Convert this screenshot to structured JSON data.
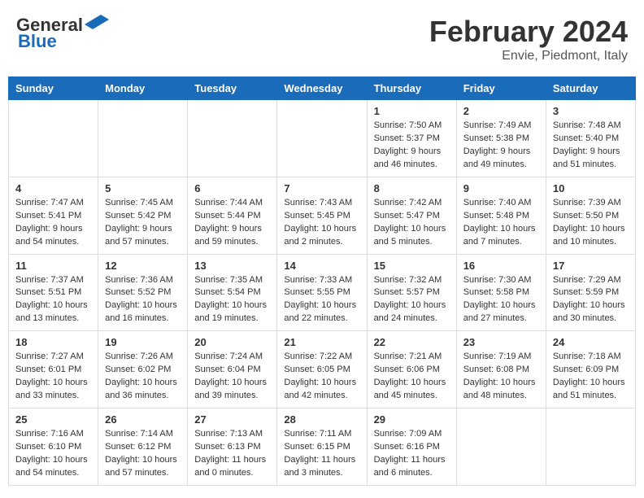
{
  "header": {
    "logo_line1": "General",
    "logo_line2": "Blue",
    "month": "February 2024",
    "location": "Envie, Piedmont, Italy"
  },
  "weekdays": [
    "Sunday",
    "Monday",
    "Tuesday",
    "Wednesday",
    "Thursday",
    "Friday",
    "Saturday"
  ],
  "weeks": [
    [
      {
        "day": "",
        "info": ""
      },
      {
        "day": "",
        "info": ""
      },
      {
        "day": "",
        "info": ""
      },
      {
        "day": "",
        "info": ""
      },
      {
        "day": "1",
        "info": "Sunrise: 7:50 AM\nSunset: 5:37 PM\nDaylight: 9 hours\nand 46 minutes."
      },
      {
        "day": "2",
        "info": "Sunrise: 7:49 AM\nSunset: 5:38 PM\nDaylight: 9 hours\nand 49 minutes."
      },
      {
        "day": "3",
        "info": "Sunrise: 7:48 AM\nSunset: 5:40 PM\nDaylight: 9 hours\nand 51 minutes."
      }
    ],
    [
      {
        "day": "4",
        "info": "Sunrise: 7:47 AM\nSunset: 5:41 PM\nDaylight: 9 hours\nand 54 minutes."
      },
      {
        "day": "5",
        "info": "Sunrise: 7:45 AM\nSunset: 5:42 PM\nDaylight: 9 hours\nand 57 minutes."
      },
      {
        "day": "6",
        "info": "Sunrise: 7:44 AM\nSunset: 5:44 PM\nDaylight: 9 hours\nand 59 minutes."
      },
      {
        "day": "7",
        "info": "Sunrise: 7:43 AM\nSunset: 5:45 PM\nDaylight: 10 hours\nand 2 minutes."
      },
      {
        "day": "8",
        "info": "Sunrise: 7:42 AM\nSunset: 5:47 PM\nDaylight: 10 hours\nand 5 minutes."
      },
      {
        "day": "9",
        "info": "Sunrise: 7:40 AM\nSunset: 5:48 PM\nDaylight: 10 hours\nand 7 minutes."
      },
      {
        "day": "10",
        "info": "Sunrise: 7:39 AM\nSunset: 5:50 PM\nDaylight: 10 hours\nand 10 minutes."
      }
    ],
    [
      {
        "day": "11",
        "info": "Sunrise: 7:37 AM\nSunset: 5:51 PM\nDaylight: 10 hours\nand 13 minutes."
      },
      {
        "day": "12",
        "info": "Sunrise: 7:36 AM\nSunset: 5:52 PM\nDaylight: 10 hours\nand 16 minutes."
      },
      {
        "day": "13",
        "info": "Sunrise: 7:35 AM\nSunset: 5:54 PM\nDaylight: 10 hours\nand 19 minutes."
      },
      {
        "day": "14",
        "info": "Sunrise: 7:33 AM\nSunset: 5:55 PM\nDaylight: 10 hours\nand 22 minutes."
      },
      {
        "day": "15",
        "info": "Sunrise: 7:32 AM\nSunset: 5:57 PM\nDaylight: 10 hours\nand 24 minutes."
      },
      {
        "day": "16",
        "info": "Sunrise: 7:30 AM\nSunset: 5:58 PM\nDaylight: 10 hours\nand 27 minutes."
      },
      {
        "day": "17",
        "info": "Sunrise: 7:29 AM\nSunset: 5:59 PM\nDaylight: 10 hours\nand 30 minutes."
      }
    ],
    [
      {
        "day": "18",
        "info": "Sunrise: 7:27 AM\nSunset: 6:01 PM\nDaylight: 10 hours\nand 33 minutes."
      },
      {
        "day": "19",
        "info": "Sunrise: 7:26 AM\nSunset: 6:02 PM\nDaylight: 10 hours\nand 36 minutes."
      },
      {
        "day": "20",
        "info": "Sunrise: 7:24 AM\nSunset: 6:04 PM\nDaylight: 10 hours\nand 39 minutes."
      },
      {
        "day": "21",
        "info": "Sunrise: 7:22 AM\nSunset: 6:05 PM\nDaylight: 10 hours\nand 42 minutes."
      },
      {
        "day": "22",
        "info": "Sunrise: 7:21 AM\nSunset: 6:06 PM\nDaylight: 10 hours\nand 45 minutes."
      },
      {
        "day": "23",
        "info": "Sunrise: 7:19 AM\nSunset: 6:08 PM\nDaylight: 10 hours\nand 48 minutes."
      },
      {
        "day": "24",
        "info": "Sunrise: 7:18 AM\nSunset: 6:09 PM\nDaylight: 10 hours\nand 51 minutes."
      }
    ],
    [
      {
        "day": "25",
        "info": "Sunrise: 7:16 AM\nSunset: 6:10 PM\nDaylight: 10 hours\nand 54 minutes."
      },
      {
        "day": "26",
        "info": "Sunrise: 7:14 AM\nSunset: 6:12 PM\nDaylight: 10 hours\nand 57 minutes."
      },
      {
        "day": "27",
        "info": "Sunrise: 7:13 AM\nSunset: 6:13 PM\nDaylight: 11 hours\nand 0 minutes."
      },
      {
        "day": "28",
        "info": "Sunrise: 7:11 AM\nSunset: 6:15 PM\nDaylight: 11 hours\nand 3 minutes."
      },
      {
        "day": "29",
        "info": "Sunrise: 7:09 AM\nSunset: 6:16 PM\nDaylight: 11 hours\nand 6 minutes."
      },
      {
        "day": "",
        "info": ""
      },
      {
        "day": "",
        "info": ""
      }
    ]
  ]
}
